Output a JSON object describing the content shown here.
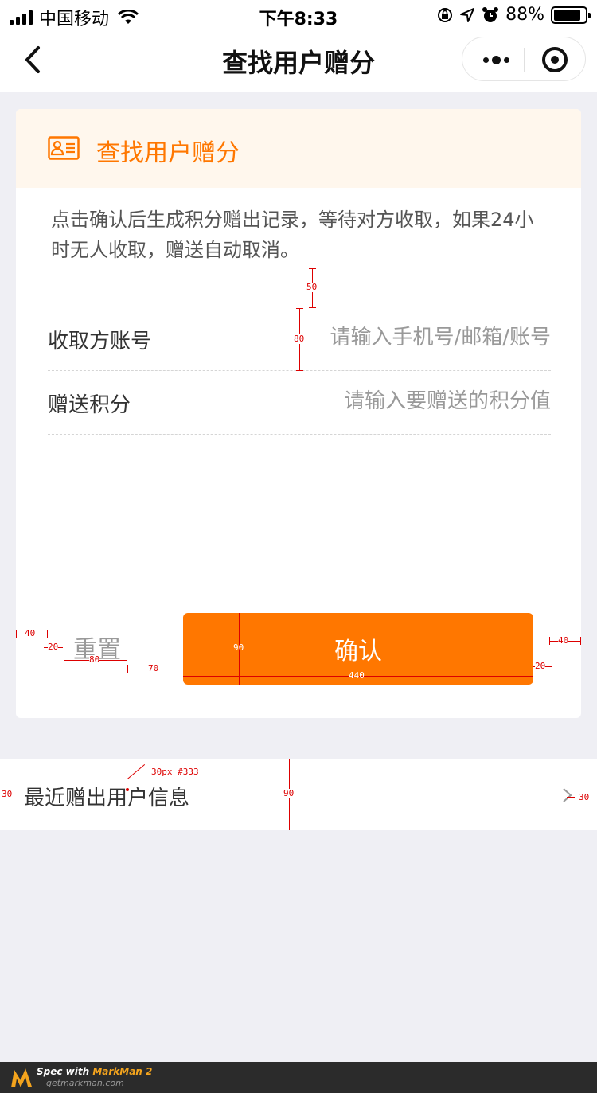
{
  "status_bar": {
    "carrier": "中国移动",
    "time": "下午8:33",
    "battery": "88%",
    "battery_level": 0.88
  },
  "nav": {
    "title": "查找用户赠分"
  },
  "card": {
    "title": "查找用户赠分",
    "description": "点击确认后生成积分赠出记录，等待对方收取，如果24小时无人收取，赠送自动取消。",
    "fields": [
      {
        "label": "收取方账号",
        "placeholder": "请输入手机号/邮箱/账号",
        "value": ""
      },
      {
        "label": "赠送积分",
        "placeholder": "请输入要赠送的积分值",
        "value": ""
      }
    ],
    "reset_label": "重置",
    "confirm_label": "确认"
  },
  "recent": {
    "label": "最近赠出用户信息"
  },
  "spec_annotations": {
    "desc_gap": "50",
    "row_height": "80",
    "left_margin": "40",
    "reset_pad": "20",
    "reset_width": "80",
    "btn_gap": "70",
    "btn_height": "90",
    "btn_width": "440",
    "btn_right_pad": "20",
    "right_margin": "40",
    "row_pad_left": "30",
    "font_note": "30px #333",
    "recent_height": "90",
    "row_pad_right": "30"
  },
  "colors": {
    "accent": "#ff7700",
    "header_bg": "#fff7ed",
    "page_bg": "#efeff4"
  },
  "footer": {
    "line1_prefix": "Spec with ",
    "line1_brand": "MarkMan 2",
    "line2": "getmarkman.com"
  }
}
